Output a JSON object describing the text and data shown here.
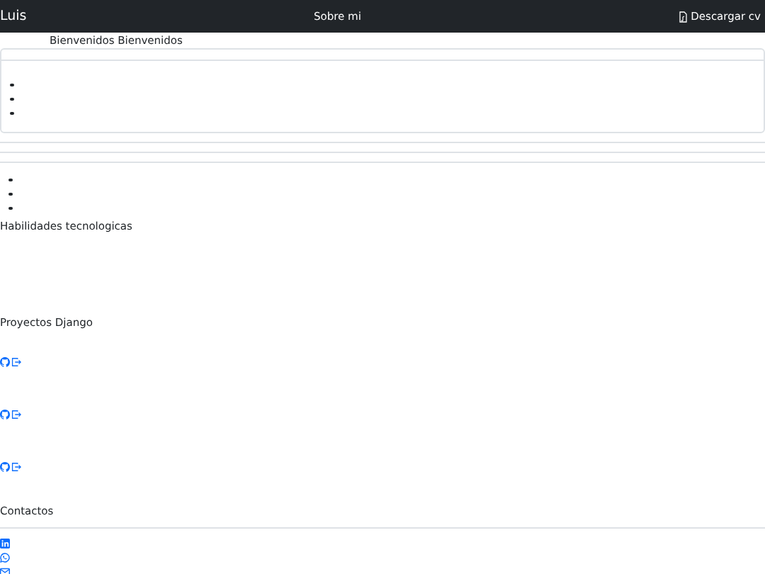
{
  "navbar": {
    "brand": "Luis",
    "link": "Sobre mi",
    "download": "Descargar cv"
  },
  "welcome": "Bienvenidos Bienvenidos",
  "card_items": [
    {
      "kind": "empty"
    },
    {
      "kind": "empty"
    },
    {
      "kind": "empty"
    }
  ],
  "list_items": [
    {
      "kind": "empty"
    },
    {
      "kind": "empty"
    },
    {
      "kind": "empty"
    }
  ],
  "skills_title": "Habilidades tecnologicas",
  "projects_title": "Proyectos Django",
  "projects": [
    {
      "kind": "links"
    },
    {
      "kind": "links"
    },
    {
      "kind": "links"
    }
  ],
  "contacts_title": "Contactos",
  "contacts": [
    {
      "kind": "linkedin"
    },
    {
      "kind": "whatsapp"
    },
    {
      "kind": "email"
    }
  ]
}
